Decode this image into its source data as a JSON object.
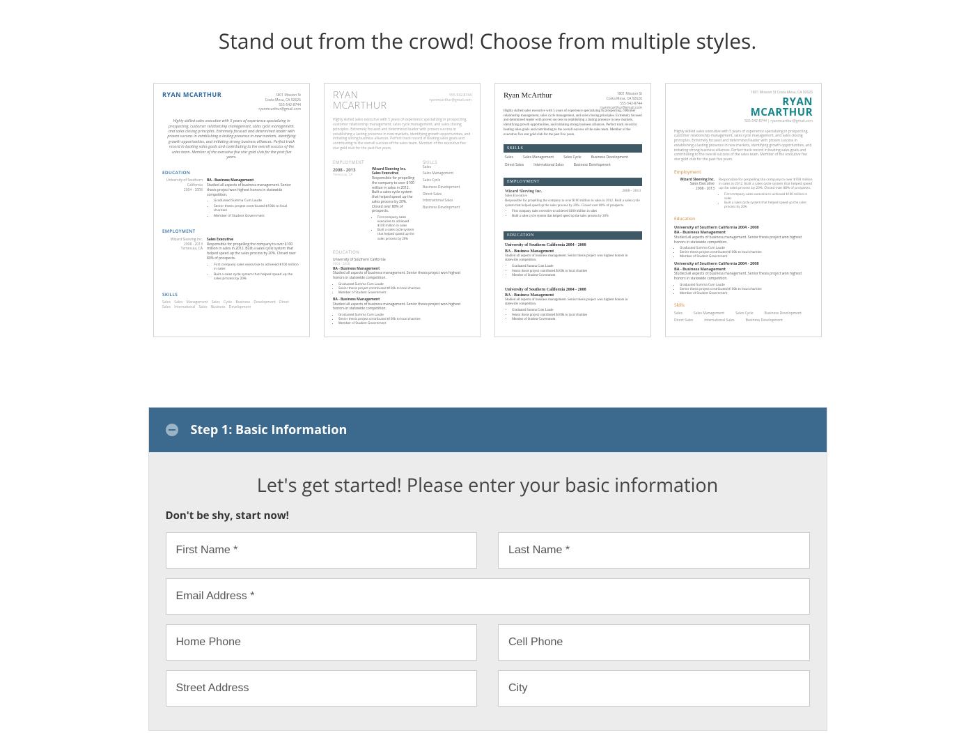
{
  "hero_heading": "Stand out from the crowd! Choose from multiple styles.",
  "resume": {
    "name": "RYAN MCARTHUR",
    "name_serif": "Ryan McArthur",
    "address": "1801 Mission St",
    "city": "Costa Mesa, CA 92626",
    "phone": "555-542-8744",
    "email": "ryanmcarthur@gmail.com",
    "top_address_full": "1801 Mission St Costa Mesa, CA 92626",
    "summary": "Highly skilled sales executive with 5 years of experience specializing in prospecting, customer relationship management, sales cycle management, and sales closing principles. Extremely focused and determined leader with proven success in establishing a lasting presence in new markets, identifying growth opportunities, and initiating strong business alliances. Perfect track record in beating sales goals and contributing to the overall success of the sales team. Member of the executive five star gold club for the past five years.",
    "sections": {
      "education": "EDUCATION",
      "employment": "EMPLOYMENT",
      "skills": "SKILLS",
      "education_cap": "Education",
      "employment_cap": "Employment",
      "skills_cap": "Skills"
    },
    "education": {
      "school": "University of Southern California",
      "years": "2004 - 2008",
      "year_range_alt": "University of Southern California 2004 - 2008",
      "degree": "BA - Business Management",
      "desc": "Studied all aspects of business management. Senior thesis project won highest honors in statewide competition.",
      "bullets": [
        "Graduated Summa Cum Laude",
        "Senior thesis project contributed $100k to local charities",
        "Member of Student Government"
      ]
    },
    "employment": {
      "company": "Wizard Sleeving Inc.",
      "location": "Temecula, CA",
      "years": "2008 - 2013",
      "title": "Sales Executive",
      "desc": "Responsible for propelling the company to over $100 million in sales in 2012. Built a sales cycle system that helped speed up the sales process by 20%. Closed over 80% of prospects.",
      "bullets": [
        "First company sales executive to achieved $100 million in sales",
        "Built a sales cycle system that helped speed up the sales process by 20%"
      ]
    },
    "skills": [
      "Sales",
      "Sales Management",
      "Sales Cycle",
      "Business Development",
      "Direct Sales",
      "International Sales",
      "Business Development"
    ],
    "skills_inline": "Sales   Sales Management   Sales Cycle   Business Development   Direct Sales   International Sales   Business Development"
  },
  "form": {
    "step_title": "Step 1: Basic Information",
    "heading": "Let's get started! Please enter your basic information",
    "sublabel": "Don't be shy, start now!",
    "fields": {
      "first_name": "First Name *",
      "last_name": "Last Name *",
      "email": "Email Address *",
      "home_phone": "Home Phone",
      "cell_phone": "Cell Phone",
      "street": "Street Address",
      "city": "City"
    }
  }
}
